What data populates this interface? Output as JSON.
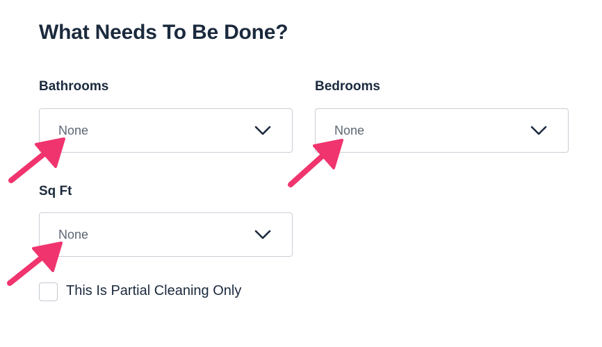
{
  "heading": "What Needs To Be Done?",
  "fields": {
    "bathrooms": {
      "label": "Bathrooms",
      "value": "None"
    },
    "bedrooms": {
      "label": "Bedrooms",
      "value": "None"
    },
    "sqft": {
      "label": "Sq Ft",
      "value": "None"
    }
  },
  "partial_cleaning": {
    "label": "This Is Partial Cleaning Only",
    "checked": false
  },
  "colors": {
    "heading": "#1b2a3d",
    "select_border": "#c9ced6",
    "placeholder": "#5d6673",
    "annotation_arrow": "#f0346e"
  },
  "icons": [
    "chevron-down-icon",
    "annotation-arrow-icon"
  ]
}
